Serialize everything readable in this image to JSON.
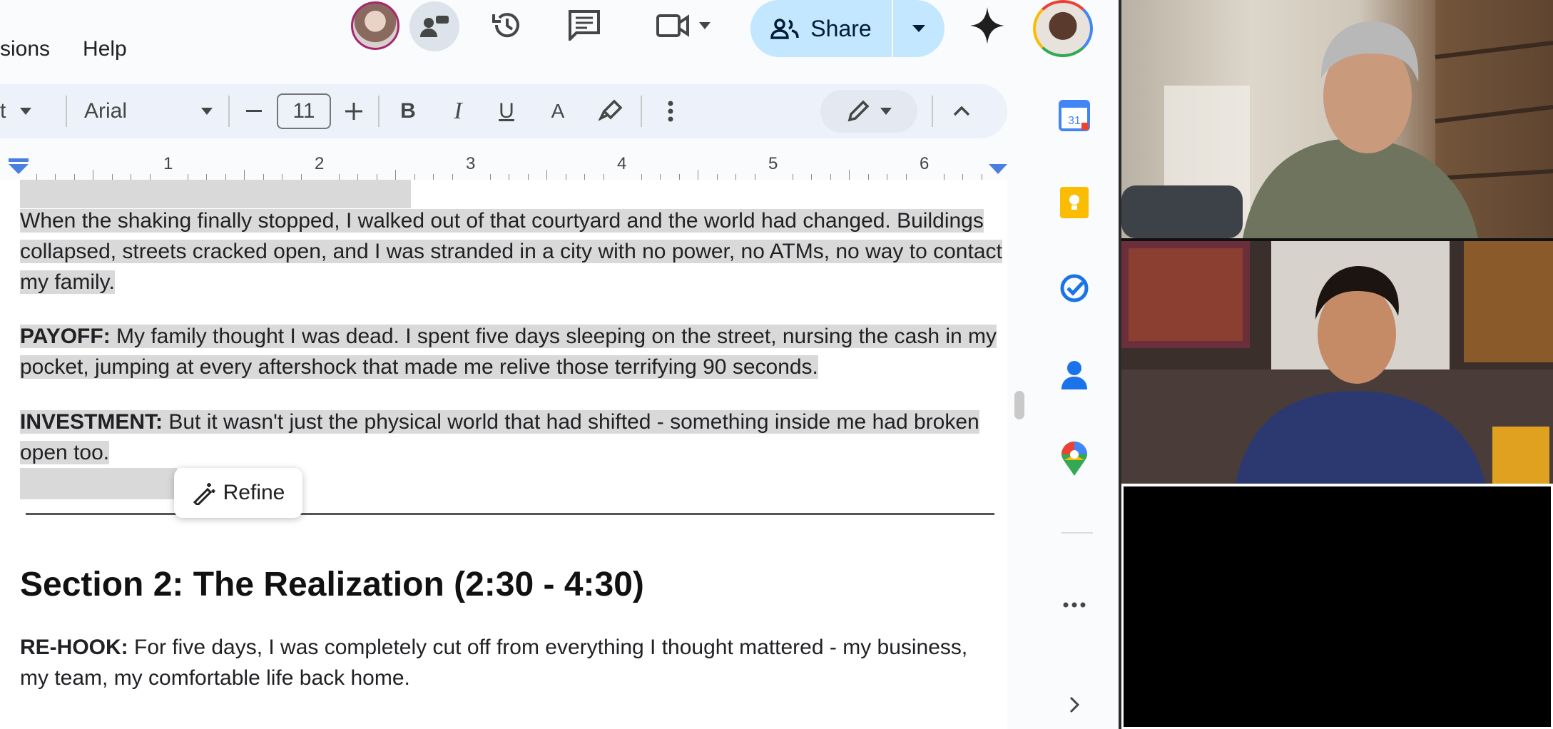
{
  "menu": {
    "extensions": "sions",
    "help": "Help"
  },
  "topbar": {
    "share_label": "Share"
  },
  "toolbar": {
    "style_partial": "t",
    "font": "Arial",
    "font_size": "11",
    "bold": "B",
    "italic": "I",
    "underline": "U",
    "text_color": "A"
  },
  "ruler": {
    "marks": [
      "1",
      "2",
      "3",
      "4",
      "5",
      "6"
    ]
  },
  "doc": {
    "para1": "When the shaking finally stopped, I walked out of that courtyard and the world had changed. Buildings collapsed, streets cracked open, and I was stranded in a city with no power, no ATMs, no way to contact my family.",
    "payoff_label": "PAYOFF:",
    "payoff_text": " My family thought I was dead. I spent five days sleeping on the street, nursing the cash in my pocket, jumping at every aftershock that made me relive those terrifying 90 seconds.",
    "investment_label": "INVESTMENT:",
    "investment_text": " But it wasn't just the physical world that had shifted - something inside me had broken open too.",
    "section_heading": "Section 2: The Realization (2:30 - 4:30)",
    "rehook_label": "RE-HOOK:",
    "rehook_text": " For five days, I was completely cut off from everything I thought mattered - my business, my team, my comfortable life back home."
  },
  "refine": {
    "label": "Refine"
  },
  "side_panel": {
    "calendar_day": "31"
  },
  "colors": {
    "accent": "#c2e7ff",
    "toolbar_bg": "#edf2fa",
    "selection": "#d9d9d9"
  }
}
